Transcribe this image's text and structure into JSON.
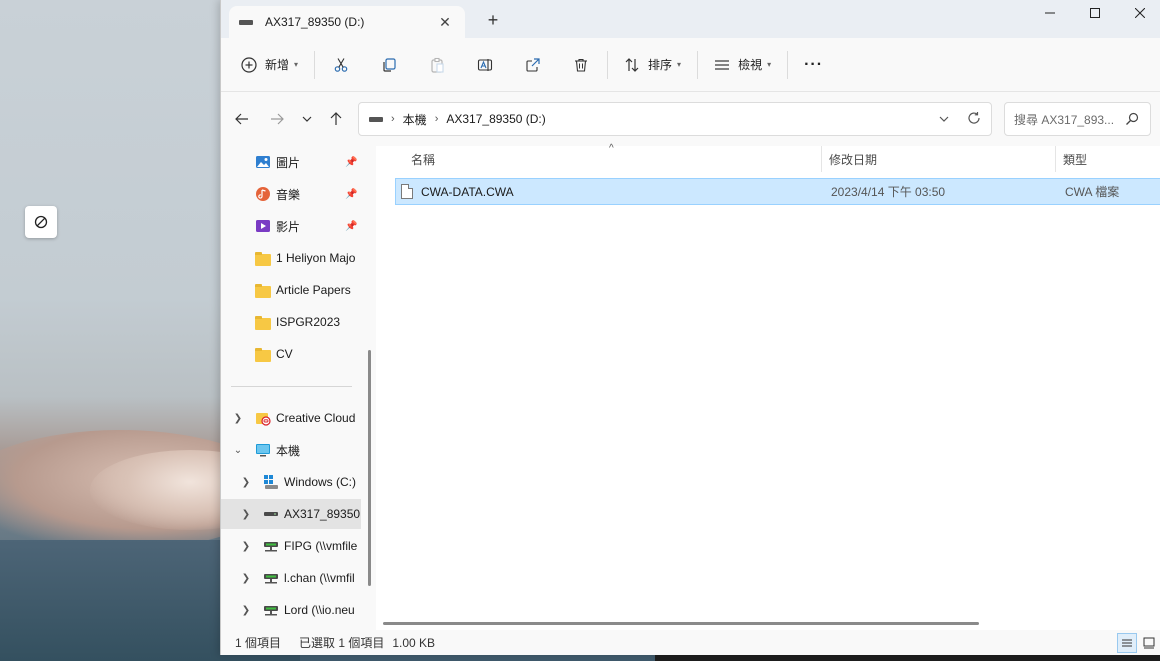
{
  "window": {
    "tab_title": "AX317_89350 (D:)",
    "close_tab_glyph": "✕",
    "new_tab_glyph": "+",
    "minimize_glyph": "—",
    "maximize_glyph": "☐",
    "close_glyph": "✕"
  },
  "toolbar": {
    "new_label": "新增",
    "sort_label": "排序",
    "view_label": "檢視",
    "more_glyph": "···"
  },
  "address": {
    "crumbs": [
      "本機",
      "AX317_89350 (D:)"
    ],
    "search_placeholder": "搜尋 AX317_893..."
  },
  "nav": {
    "quick_access": [
      {
        "label": "圖片",
        "icon": "pictures-icon",
        "pinned": true
      },
      {
        "label": "音樂",
        "icon": "music-icon",
        "pinned": true
      },
      {
        "label": "影片",
        "icon": "videos-icon",
        "pinned": true
      },
      {
        "label": "1 Heliyon Majo",
        "icon": "folder-icon"
      },
      {
        "label": "Article Papers",
        "icon": "folder-icon"
      },
      {
        "label": "ISPGR2023",
        "icon": "folder-icon"
      },
      {
        "label": "CV",
        "icon": "folder-icon"
      }
    ],
    "tree": [
      {
        "label": "Creative Cloud",
        "icon": "creative-cloud-icon"
      },
      {
        "label": "本機",
        "icon": "this-pc-icon"
      },
      {
        "label": "Windows (C:)",
        "icon": "windows-drive-icon"
      },
      {
        "label": "AX317_89350",
        "icon": "drive-icon"
      },
      {
        "label": "FIPG (\\\\vmfile",
        "icon": "network-drive-icon"
      },
      {
        "label": "l.chan (\\\\vmfil",
        "icon": "network-drive-icon"
      },
      {
        "label": "Lord (\\\\io.neu",
        "icon": "network-drive-icon"
      }
    ]
  },
  "columns": {
    "name": "名稱",
    "modified": "修改日期",
    "type": "類型"
  },
  "files": [
    {
      "name": "CWA-DATA.CWA",
      "modified": "2023/4/14 下午 03:50",
      "type": "CWA 檔案"
    }
  ],
  "status": {
    "count": "1 個項目",
    "selected": "已選取 1 個項目",
    "size": "1.00 KB"
  },
  "colors": {
    "selection": "#cce8ff",
    "selection_border": "#99d1ff",
    "folder": "#f7c844"
  }
}
